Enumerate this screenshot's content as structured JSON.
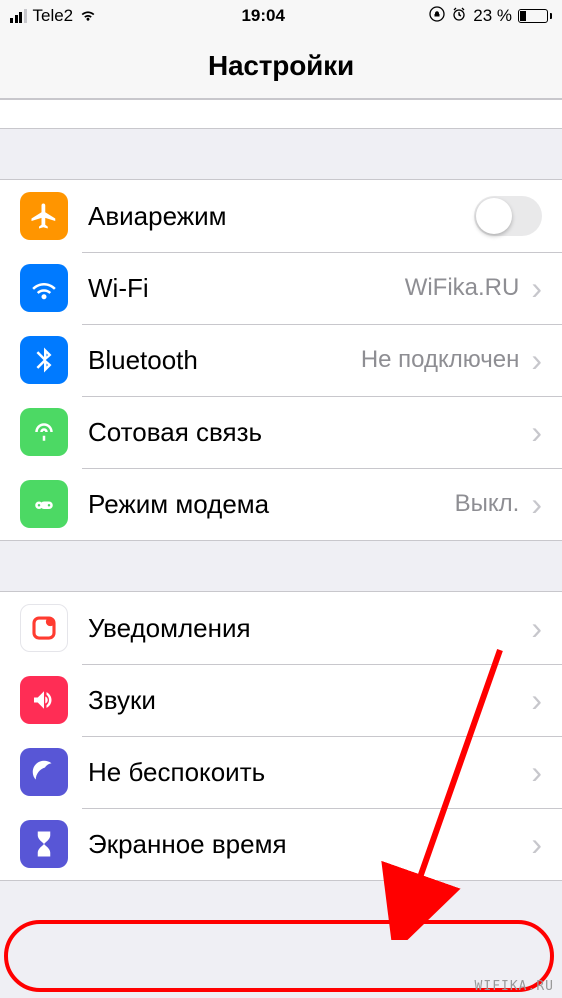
{
  "status_bar": {
    "carrier": "Tele2",
    "time": "19:04",
    "battery_percent": "23 %"
  },
  "header": {
    "title": "Настройки"
  },
  "group1": {
    "airplane": {
      "label": "Авиарежим"
    },
    "wifi": {
      "label": "Wi-Fi",
      "value": "WiFika.RU"
    },
    "bluetooth": {
      "label": "Bluetooth",
      "value": "Не подключен"
    },
    "cellular": {
      "label": "Сотовая связь"
    },
    "hotspot": {
      "label": "Режим модема",
      "value": "Выкл."
    }
  },
  "group2": {
    "notifications": {
      "label": "Уведомления"
    },
    "sounds": {
      "label": "Звуки"
    },
    "dnd": {
      "label": "Не беспокоить"
    },
    "screentime": {
      "label": "Экранное время"
    }
  },
  "watermark": "WIFIKA.RU"
}
